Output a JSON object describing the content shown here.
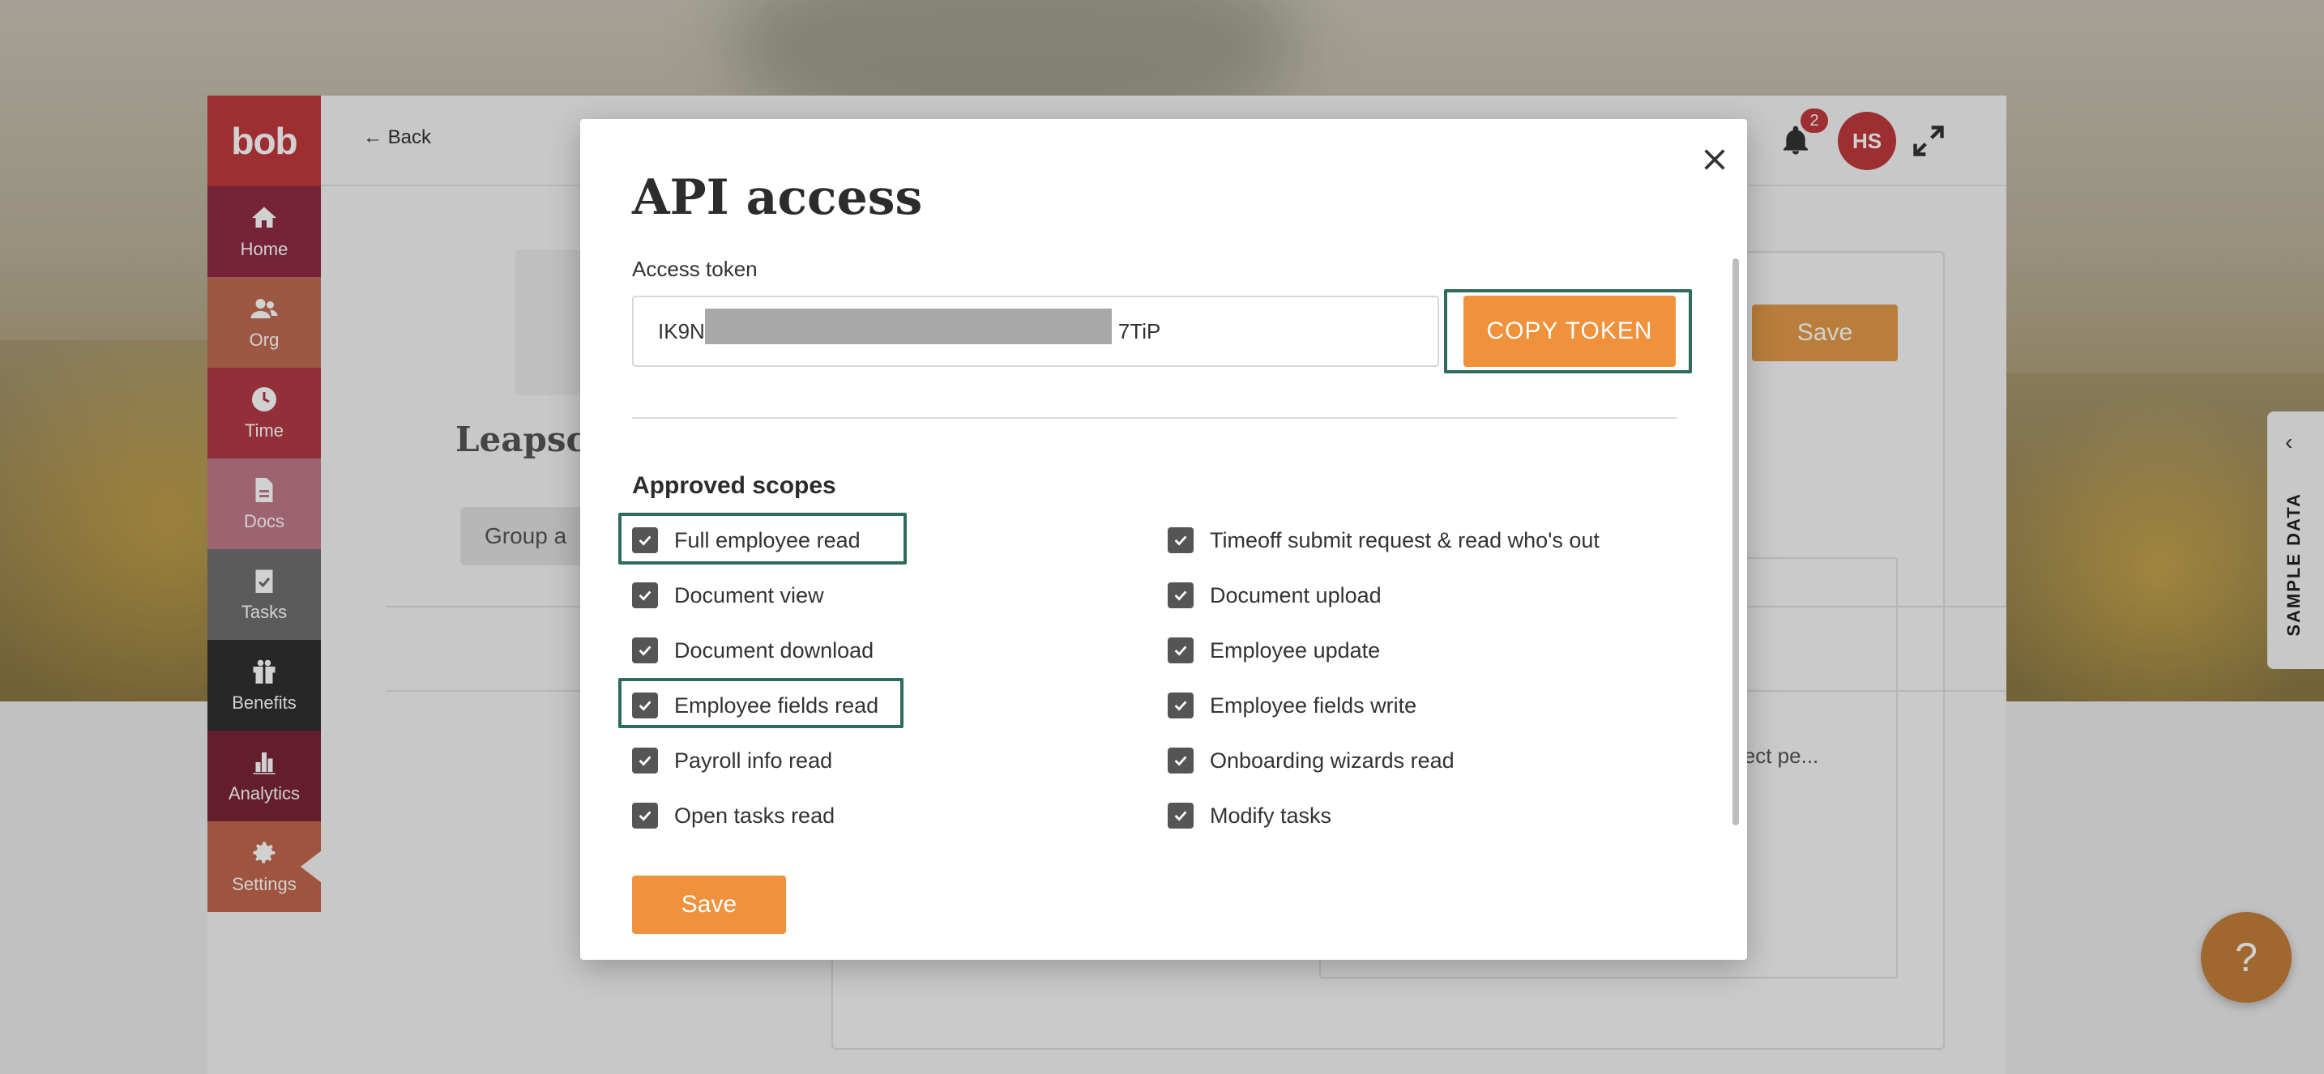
{
  "app": {
    "logo": "bob",
    "back_label": "Back",
    "notifications_count": "2",
    "avatar_initials": "HS"
  },
  "sidebar": {
    "items": [
      {
        "label": "Home",
        "icon": "home-icon"
      },
      {
        "label": "Org",
        "icon": "people-icon"
      },
      {
        "label": "Time",
        "icon": "clock-icon"
      },
      {
        "label": "Docs",
        "icon": "document-icon"
      },
      {
        "label": "Tasks",
        "icon": "clipboard-check-icon"
      },
      {
        "label": "Benefits",
        "icon": "gift-icon"
      },
      {
        "label": "Analytics",
        "icon": "bar-chart-icon"
      },
      {
        "label": "Settings",
        "icon": "gear-icon"
      }
    ]
  },
  "background_page": {
    "title_fragment": "Leapsc",
    "group_button_fragment": "Group a",
    "save_label": "Save",
    "text_fragment": "lect pe..."
  },
  "side_tab": {
    "label": "SAMPLE DATA"
  },
  "help": {
    "label": "?"
  },
  "modal": {
    "title": "API access",
    "token_label": "Access token",
    "token_prefix": "IK9N",
    "token_suffix": "7TiP",
    "copy_button": "COPY TOKEN",
    "scopes_title": "Approved scopes",
    "scopes_left": [
      {
        "label": "Full employee read",
        "checked": true,
        "highlighted": true
      },
      {
        "label": "Document view",
        "checked": true,
        "highlighted": false
      },
      {
        "label": "Document download",
        "checked": true,
        "highlighted": false
      },
      {
        "label": "Employee fields read",
        "checked": true,
        "highlighted": true
      },
      {
        "label": "Payroll info read",
        "checked": true,
        "highlighted": false
      },
      {
        "label": "Open tasks read",
        "checked": true,
        "highlighted": false
      }
    ],
    "scopes_right": [
      {
        "label": "Timeoff submit request & read who's out",
        "checked": true
      },
      {
        "label": "Document upload",
        "checked": true
      },
      {
        "label": "Employee update",
        "checked": true
      },
      {
        "label": "Employee fields write",
        "checked": true
      },
      {
        "label": "Onboarding wizards read",
        "checked": true
      },
      {
        "label": "Modify tasks",
        "checked": true
      }
    ],
    "save_label": "Save"
  },
  "colors": {
    "accent_orange": "#f0913c",
    "highlight_green": "#2e6b5d",
    "brand_red": "#c0393e"
  }
}
